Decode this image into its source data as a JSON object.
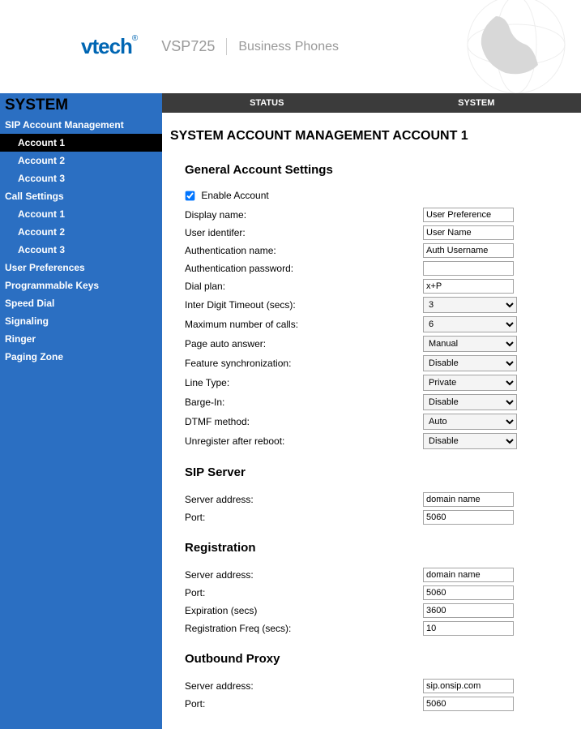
{
  "header": {
    "brand": "vtech",
    "product": "VSP725",
    "tagline": "Business Phones"
  },
  "tabs": {
    "status": "STATUS",
    "system": "SYSTEM"
  },
  "sidebar": {
    "system": "SYSTEM",
    "sip_mgmt": "SIP Account Management",
    "acct1": "Account 1",
    "acct2": "Account 2",
    "acct3": "Account 3",
    "call_settings": "Call Settings",
    "cs_acct1": "Account 1",
    "cs_acct2": "Account 2",
    "cs_acct3": "Account 3",
    "user_prefs": "User Preferences",
    "prog_keys": "Programmable Keys",
    "speed_dial": "Speed Dial",
    "signaling": "Signaling",
    "ringer": "Ringer",
    "paging": "Paging Zone"
  },
  "page": {
    "title": "SYSTEM ACCOUNT MANAGEMENT ACCOUNT 1",
    "general_heading": "General Account Settings",
    "enable_account_label": "Enable Account",
    "display_name_label": "Display name:",
    "user_identifier_label": "User identifer:",
    "auth_name_label": "Authentication name:",
    "auth_pw_label": "Authentication password:",
    "dial_plan_label": "Dial plan:",
    "inter_digit_label": "Inter Digit Timeout (secs):",
    "max_calls_label": "Maximum number of calls:",
    "page_auto_answer_label": "Page auto answer:",
    "feature_sync_label": "Feature synchronization:",
    "line_type_label": "Line Type:",
    "barge_in_label": "Barge-In:",
    "dtmf_label": "DTMF method:",
    "unregister_label": "Unregister after reboot:",
    "sip_heading": "SIP Server",
    "server_addr_label": "Server address:",
    "port_label": "Port:",
    "reg_heading": "Registration",
    "reg_server_addr_label": "Server address:",
    "reg_port_label": "Port:",
    "expiration_label": "Expiration (secs)",
    "reg_freq_label": "Registration Freq (secs):",
    "outbound_heading": "Outbound Proxy",
    "ob_server_addr_label": "Server address:",
    "ob_port_label": "Port:"
  },
  "values": {
    "display_name": "User Preference",
    "user_identifier": "User Name",
    "auth_name": "Auth Username",
    "auth_pw": "",
    "dial_plan": "x+P",
    "inter_digit": "3",
    "max_calls": "6",
    "page_auto_answer": "Manual",
    "feature_sync": "Disable",
    "line_type": "Private",
    "barge_in": "Disable",
    "dtmf": "Auto",
    "unregister": "Disable",
    "sip_server": "domain name",
    "sip_port": "5060",
    "reg_server": "domain name",
    "reg_port": "5060",
    "expiration": "3600",
    "reg_freq": "10",
    "ob_server": "sip.onsip.com",
    "ob_port": "5060"
  }
}
